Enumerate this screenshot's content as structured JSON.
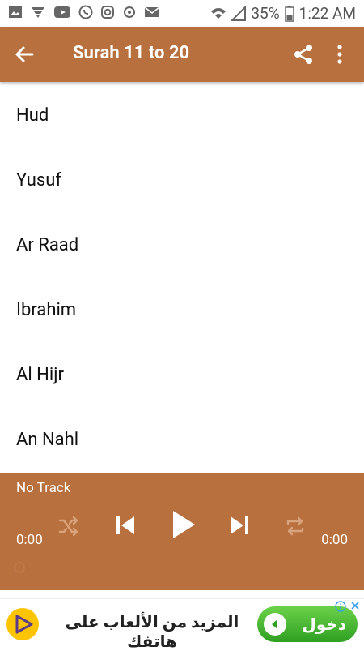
{
  "status_bar": {
    "battery": "35%",
    "time": "1:22 AM"
  },
  "app_bar": {
    "title": "Surah 11 to 20"
  },
  "list": {
    "items": [
      {
        "label": "Hud"
      },
      {
        "label": "Yusuf"
      },
      {
        "label": "Ar Raad"
      },
      {
        "label": "Ibrahim"
      },
      {
        "label": "Al Hijr"
      },
      {
        "label": "An Nahl"
      }
    ]
  },
  "player": {
    "track_label": "No Track",
    "elapsed": "0:00",
    "duration": "0:00"
  },
  "ad": {
    "text": "المزيد من الألعاب على هاتفك",
    "button_label": "دخول"
  },
  "colors": {
    "primary": "#b8703e"
  }
}
